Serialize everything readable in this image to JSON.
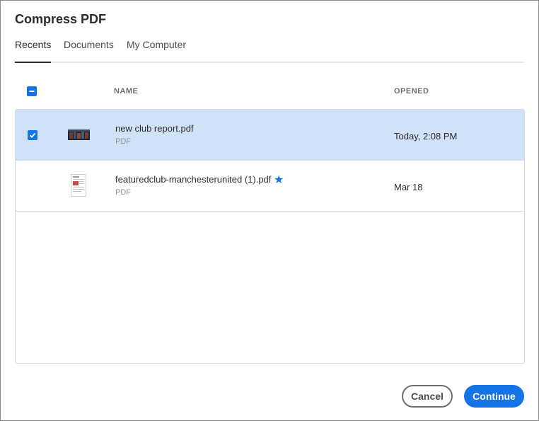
{
  "dialog": {
    "title": "Compress PDF",
    "tabs": [
      {
        "label": "Recents",
        "active": true
      },
      {
        "label": "Documents",
        "active": false
      },
      {
        "label": "My Computer",
        "active": false
      }
    ],
    "columns": {
      "name": "NAME",
      "opened": "OPENED"
    },
    "files": [
      {
        "name": "new club report.pdf",
        "type": "PDF",
        "opened": "Today, 2:08 PM",
        "selected": true,
        "starred": false,
        "thumbnail_icon": "photo-thumbnail"
      },
      {
        "name": "featuredclub-manchesterunited (1).pdf",
        "type": "PDF",
        "opened": "Mar 18",
        "selected": false,
        "starred": true,
        "thumbnail_icon": "document-thumbnail"
      }
    ],
    "buttons": {
      "cancel": "Cancel",
      "continue": "Continue"
    },
    "colors": {
      "accent": "#1473e6",
      "selected_row": "#d0e2f8"
    }
  }
}
